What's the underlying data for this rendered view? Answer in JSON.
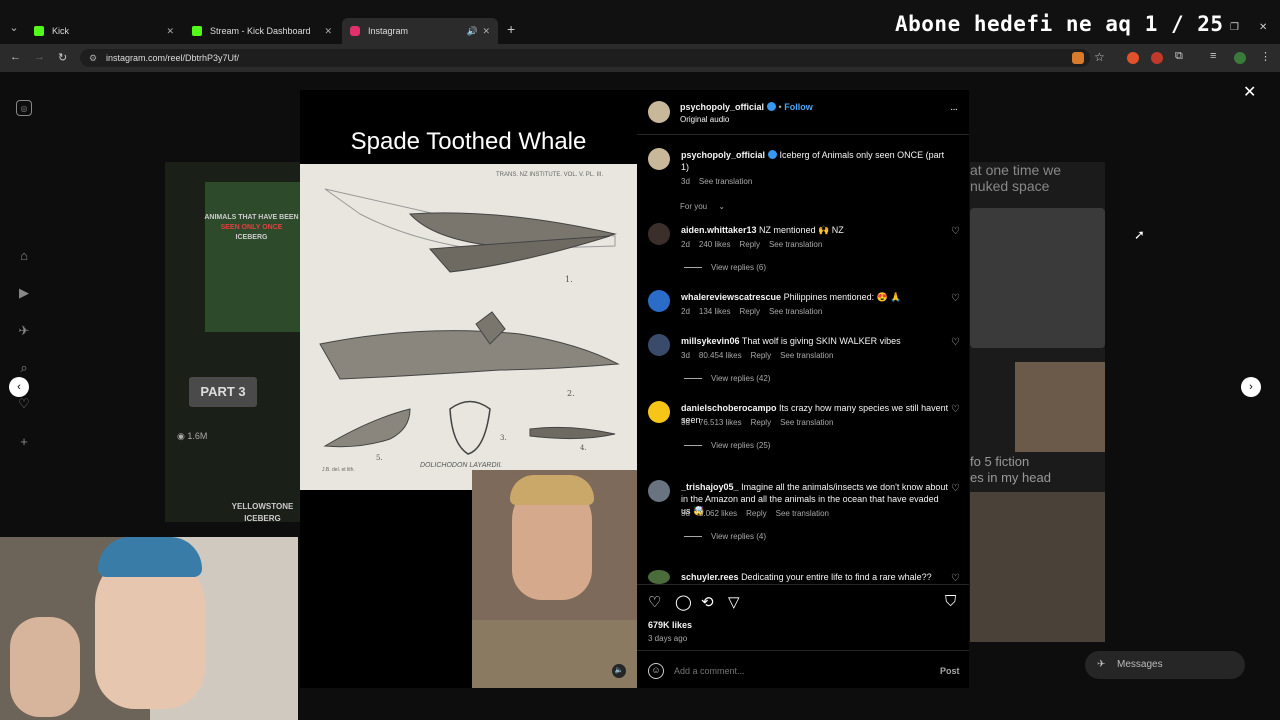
{
  "browser": {
    "tabs": [
      {
        "label": "Kick",
        "color": "#53fc18"
      },
      {
        "label": "Stream - Kick Dashboard",
        "color": "#53fc18"
      },
      {
        "label": "Instagram",
        "color": "#e1306c"
      }
    ],
    "new_tab": "+",
    "url": "instagram.com/reel/DbtrhP3y7Uf/"
  },
  "stream_overlay": {
    "title": "Abone hedefi ne aq 1 / 25"
  },
  "background": {
    "left_reel": {
      "iceberg_line1": "ANIMALS THAT HAVE BEEN",
      "iceberg_line2": "SEEN ONLY ONCE",
      "iceberg_line3": "ICEBERG",
      "part": "PART 3",
      "views": "1.6M",
      "yellowstone1": "YELLOWSTONE",
      "yellowstone2": "ICEBERG"
    },
    "right_reel": {
      "line1": "at one time we",
      "line2": "nuked space",
      "line3": "fo 5 fiction",
      "line4": "es in my head"
    },
    "messages": "Messages"
  },
  "reel": {
    "video_title": "Spade Toothed Whale",
    "plate_header": "TRANS. NZ INSTITUTE. VOL. V. PL. III.",
    "plate_caption": "DOLICHODON LAYARDII.",
    "plate_credit": "J.B. del. et lith."
  },
  "panel": {
    "author": "psychopoly_official",
    "follow": "Follow",
    "dot": "•",
    "audio": "Original audio",
    "more": "···",
    "caption": {
      "user": "psychopoly_official",
      "text": "Iceberg of Animals only seen ONCE (part 1)",
      "age": "3d",
      "translate": "See translation"
    },
    "for_you": "For you",
    "comments": [
      {
        "user": "aiden.whittaker13",
        "text": "NZ mentioned 🙌 NZ",
        "age": "2d",
        "likes": "240 likes",
        "reply": "Reply",
        "translate": "See translation",
        "replies": "View replies (6)",
        "avatar": "#3b2f2b"
      },
      {
        "user": "whalereviewscatrescue",
        "text": "Philippines mentioned: 😍 🙏",
        "age": "2d",
        "likes": "134 likes",
        "reply": "Reply",
        "translate": "See translation",
        "replies": "",
        "avatar": "#2a6cc7"
      },
      {
        "user": "millsykevin06",
        "text": "That wolf is giving SKIN WALKER vibes",
        "age": "3d",
        "likes": "80.454 likes",
        "reply": "Reply",
        "translate": "See translation",
        "replies": "View replies (42)",
        "avatar": "#3a4a6a"
      },
      {
        "user": "danielschoberocampo",
        "text": "Its crazy how many species we still havent seen",
        "age": "3d",
        "likes": "76.513 likes",
        "reply": "Reply",
        "translate": "See translation",
        "replies": "View replies (25)",
        "avatar": "#f5c518"
      },
      {
        "user": "_trishajoy05_",
        "text": "Imagine all the animals/insects we don't know about in the Amazon and all the animals in the ocean that have evaded us 🤯",
        "age": "3d",
        "likes": "3.062 likes",
        "reply": "Reply",
        "translate": "See translation",
        "replies": "View replies (4)",
        "avatar": "#6a7380"
      },
      {
        "user": "schuyler.rees",
        "text": "Dedicating your entire life to find a rare whale??",
        "age": "",
        "likes": "",
        "reply": "",
        "translate": "",
        "replies": "",
        "avatar": "#4a6b3a"
      }
    ],
    "likes": "679K likes",
    "posted": "3 days ago",
    "add_comment_placeholder": "Add a comment...",
    "post": "Post"
  },
  "colors": {
    "accent": "#3897f0",
    "follow": "#4ea5f5"
  }
}
